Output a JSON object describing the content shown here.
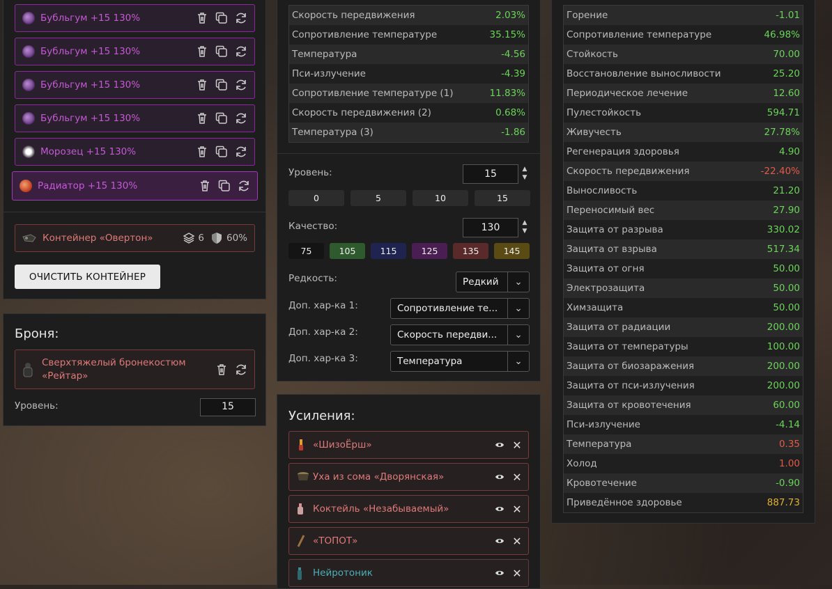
{
  "artifacts": [
    {
      "label": "Бубльгум +15 130%",
      "icon": "bubblegum-icon",
      "color": "#8a5aa8"
    },
    {
      "label": "Бубльгум +15 130%",
      "icon": "bubblegum-icon",
      "color": "#8a5aa8"
    },
    {
      "label": "Бубльгум +15 130%",
      "icon": "bubblegum-icon",
      "color": "#8a5aa8"
    },
    {
      "label": "Бубльгум +15 130%",
      "icon": "bubblegum-icon",
      "color": "#8a5aa8"
    },
    {
      "label": "Морозец +15 130%",
      "icon": "frost-icon",
      "color": "#ffffff"
    },
    {
      "label": "Радиатор +15 130%",
      "icon": "radiator-icon",
      "color": "#e0502a"
    }
  ],
  "container": {
    "label": "Контейнер «Овертон»",
    "slots": "6",
    "protection": "60%"
  },
  "clear_button": "ОЧИСТИТЬ КОНТЕЙНЕР",
  "armor": {
    "title": "Броня:",
    "name_line1": "Сверхтяжелый бронекостюм",
    "name_line2": "«Рейтар»",
    "level_label": "Уровень:",
    "level": "15"
  },
  "artifact_stats": [
    {
      "label": "Скорость передвижения",
      "value": "2.03%",
      "tone": "pos"
    },
    {
      "label": "Сопротивление температуре",
      "value": "35.15%",
      "tone": "pos"
    },
    {
      "label": "Температура",
      "value": "-4.56",
      "tone": "pos"
    },
    {
      "label": "Пси-излучение",
      "value": "-4.39",
      "tone": "pos"
    },
    {
      "label": "Сопротивление температуре (1)",
      "value": "11.83%",
      "tone": "pos"
    },
    {
      "label": "Скорость передвижения (2)",
      "value": "0.68%",
      "tone": "pos"
    },
    {
      "label": "Температура (3)",
      "value": "-1.86",
      "tone": "pos"
    }
  ],
  "level": {
    "label": "Уровень:",
    "value": "15",
    "presets": [
      "0",
      "5",
      "10",
      "15"
    ]
  },
  "quality": {
    "label": "Качество:",
    "value": "130",
    "presets": [
      {
        "label": "75",
        "bg": "#141414"
      },
      {
        "label": "105",
        "bg": "#2e5a2e"
      },
      {
        "label": "115",
        "bg": "#1e2350"
      },
      {
        "label": "125",
        "bg": "#4a1e52"
      },
      {
        "label": "135",
        "bg": "#5a2a2a"
      },
      {
        "label": "145",
        "bg": "#5a4a14"
      }
    ]
  },
  "rarity": {
    "label": "Редкость:",
    "value": "Редкий"
  },
  "extra1": {
    "label": "Доп. хар-ка 1:",
    "value": "Сопротивление те..."
  },
  "extra2": {
    "label": "Доп. хар-ка 2:",
    "value": "Скорость передви..."
  },
  "extra3": {
    "label": "Доп. хар-ка 3:",
    "value": "Температура"
  },
  "boosts_title": "Усиления:",
  "boosts": [
    {
      "label": "«ШизоЁрш»",
      "icon": "brush-icon",
      "tone": ""
    },
    {
      "label": "Уха из сома «Дворянская»",
      "icon": "pot-icon",
      "tone": ""
    },
    {
      "label": "Коктейль «Незабываемый»",
      "icon": "bottle-icon",
      "tone": ""
    },
    {
      "label": "«ТОПОТ»",
      "icon": "stick-icon",
      "tone": ""
    },
    {
      "label": "Нейротоник",
      "icon": "vial-icon",
      "tone": "cyan"
    }
  ],
  "total_stats": [
    {
      "label": "Горение",
      "value": "-1.01",
      "tone": "pos"
    },
    {
      "label": "Сопротивление температуре",
      "value": "46.98%",
      "tone": "pos"
    },
    {
      "label": "Стойкость",
      "value": "70.00",
      "tone": "pos"
    },
    {
      "label": "Восстановление выносливости",
      "value": "25.20",
      "tone": "pos"
    },
    {
      "label": "Периодическое лечение",
      "value": "12.60",
      "tone": "pos"
    },
    {
      "label": "Пулестойкость",
      "value": "594.71",
      "tone": "pos"
    },
    {
      "label": "Живучесть",
      "value": "27.78%",
      "tone": "pos"
    },
    {
      "label": "Регенерация здоровья",
      "value": "4.90",
      "tone": "pos"
    },
    {
      "label": "Скорость передвижения",
      "value": "-22.40%",
      "tone": "neg"
    },
    {
      "label": "Выносливость",
      "value": "21.20",
      "tone": "pos"
    },
    {
      "label": "Переносимый вес",
      "value": "27.90",
      "tone": "pos"
    },
    {
      "label": "Защита от разрыва",
      "value": "330.02",
      "tone": "pos"
    },
    {
      "label": "Защита от взрыва",
      "value": "517.34",
      "tone": "pos"
    },
    {
      "label": "Защита от огня",
      "value": "50.00",
      "tone": "pos"
    },
    {
      "label": "Электрозащита",
      "value": "50.00",
      "tone": "pos"
    },
    {
      "label": "Химзащита",
      "value": "50.00",
      "tone": "pos"
    },
    {
      "label": "Защита от радиации",
      "value": "200.00",
      "tone": "pos"
    },
    {
      "label": "Защита от температуры",
      "value": "100.00",
      "tone": "pos"
    },
    {
      "label": "Защита от биозаражения",
      "value": "200.00",
      "tone": "pos"
    },
    {
      "label": "Защита от пси-излучения",
      "value": "200.00",
      "tone": "pos"
    },
    {
      "label": "Защита от кровотечения",
      "value": "60.00",
      "tone": "pos"
    },
    {
      "label": "Пси-излучение",
      "value": "-4.14",
      "tone": "pos"
    },
    {
      "label": "Температура",
      "value": "0.35",
      "tone": "neg"
    },
    {
      "label": "Холод",
      "value": "1.00",
      "tone": "neg"
    },
    {
      "label": "Кровотечение",
      "value": "-0.90",
      "tone": "pos"
    },
    {
      "label": "Приведённое здоровье",
      "value": "887.73",
      "tone": "gold"
    }
  ]
}
